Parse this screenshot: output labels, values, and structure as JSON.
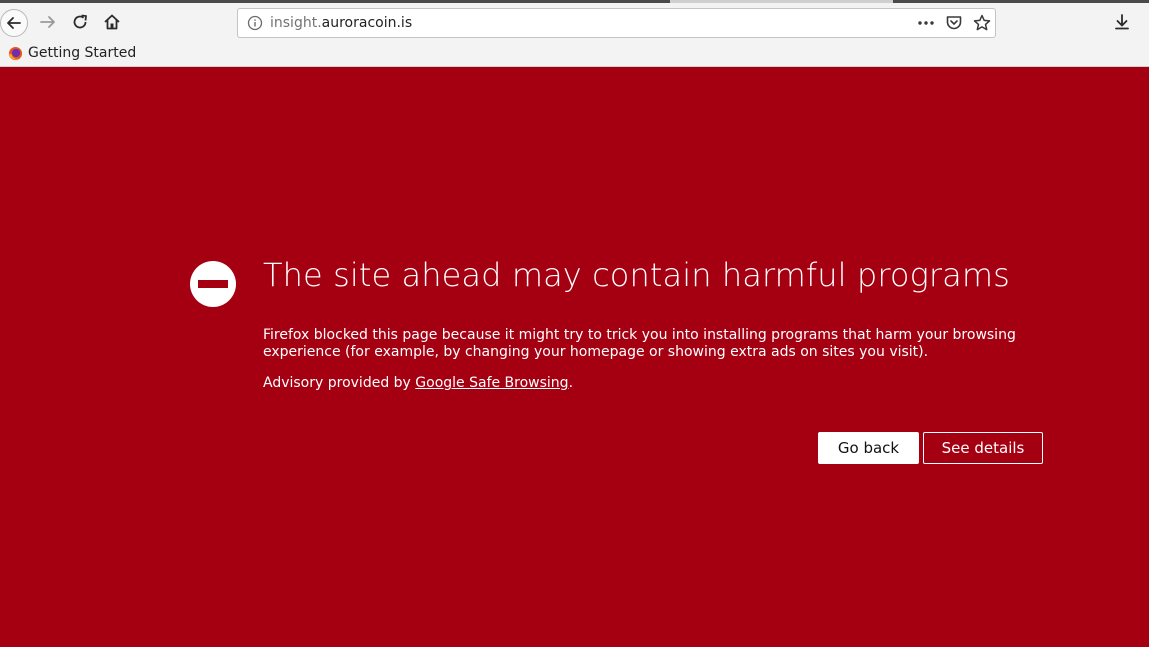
{
  "browser": {
    "url_subdomain": "insight.",
    "url_domain": "auroracoin.is",
    "bookmark_label": "Getting Started"
  },
  "page": {
    "title": "The site ahead may contain harmful programs",
    "description": "Firefox blocked this page because it might try to trick you into installing programs that harm your browsing experience (for example, by changing your homepage or showing extra ads on sites you visit).",
    "advisory_prefix": "Advisory provided by ",
    "advisory_link": "Google Safe Browsing",
    "advisory_suffix": ".",
    "go_back_label": "Go back",
    "see_details_label": "See details"
  },
  "colors": {
    "background": "#a50012",
    "toolbar": "#f3f3f3",
    "text": "#ffffff"
  },
  "icons": [
    "back-arrow-icon",
    "forward-arrow-icon",
    "reload-icon",
    "home-icon",
    "info-icon",
    "more-actions-icon",
    "pocket-icon",
    "bookmark-star-icon",
    "download-icon",
    "firefox-logo-icon",
    "stop-sign-icon"
  ]
}
